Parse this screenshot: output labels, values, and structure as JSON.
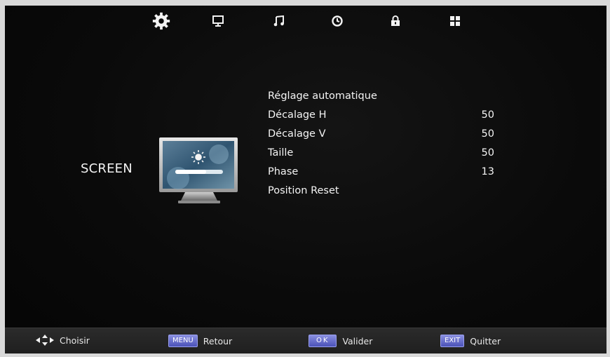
{
  "tabs": [
    {
      "icon": "gear-icon",
      "active": true
    },
    {
      "icon": "monitor-icon",
      "active": false
    },
    {
      "icon": "music-note-icon",
      "active": false
    },
    {
      "icon": "clock-icon",
      "active": false
    },
    {
      "icon": "lock-icon",
      "active": false
    },
    {
      "icon": "grid-icon",
      "active": false
    }
  ],
  "section": {
    "title": "SCREEN",
    "preview_icon": "monitor-brightness-icon"
  },
  "menu": {
    "items": [
      {
        "label": "Réglage automatique",
        "value": ""
      },
      {
        "label": "Décalage H",
        "value": "50"
      },
      {
        "label": "Décalage V",
        "value": "50"
      },
      {
        "label": "Taille",
        "value": "50"
      },
      {
        "label": "Phase",
        "value": "13"
      },
      {
        "label": "Position Reset",
        "value": ""
      }
    ]
  },
  "help": {
    "choose": {
      "icon": "dpad-icon",
      "label": "Choisir"
    },
    "back": {
      "key": "MENU",
      "label": "Retour"
    },
    "confirm": {
      "key": "OK",
      "label": "Valider"
    },
    "exit": {
      "key": "EXIT",
      "label": "Quitter"
    }
  },
  "colors": {
    "background": "#0a0a0a",
    "text": "#f4f4f4",
    "keycap": "#5a61c8",
    "helpbar": "#262626"
  }
}
